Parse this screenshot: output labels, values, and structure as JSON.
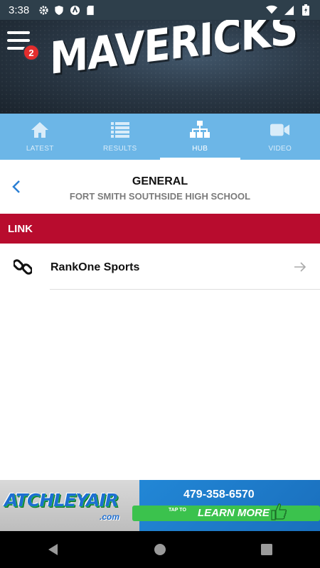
{
  "status_bar": {
    "time": "3:38",
    "left_icons": [
      "settings-icon",
      "shield-icon",
      "vpn-icon",
      "sd-card-icon"
    ],
    "right_icons": [
      "wifi-icon",
      "cell-signal-icon",
      "battery-icon"
    ]
  },
  "header": {
    "brand": "MAVERICKS",
    "menu_badge_count": "2"
  },
  "tabs": [
    {
      "label": "LATEST",
      "icon": "home-icon",
      "active": false
    },
    {
      "label": "RESULTS",
      "icon": "list-icon",
      "active": false
    },
    {
      "label": "HUB",
      "icon": "hierarchy-icon",
      "active": true
    },
    {
      "label": "VIDEO",
      "icon": "video-camera-icon",
      "active": false
    }
  ],
  "sub_header": {
    "title": "GENERAL",
    "subtitle": "FORT SMITH SOUTHSIDE HIGH SCHOOL"
  },
  "section": {
    "title": "LINK"
  },
  "links": [
    {
      "label": "RankOne Sports",
      "icon": "chain-link-icon"
    }
  ],
  "ad": {
    "brand": "ATCHLEYAIR",
    "brand_suffix": ".com",
    "phone": "479-358-6570",
    "tap_to": "TAP TO",
    "cta": "LEARN MORE"
  },
  "nav_bar": {
    "buttons": [
      "back-icon",
      "home-icon",
      "recents-icon"
    ]
  },
  "colors": {
    "tab_bar": "#6cb6e7",
    "section_header": "#b80c2e",
    "back_chevron": "#2a7fd4",
    "badge": "#e32d2d"
  }
}
